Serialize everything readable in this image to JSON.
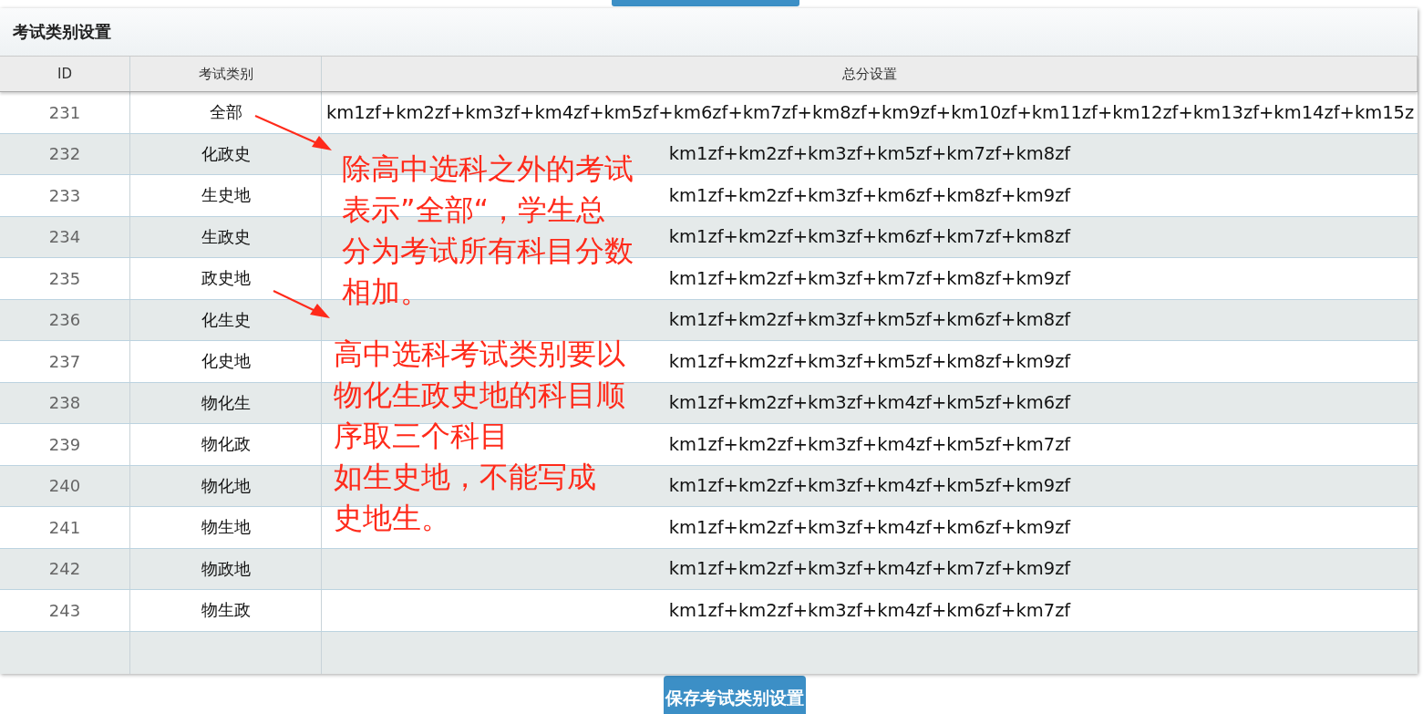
{
  "panel": {
    "title": "考试类别设置"
  },
  "table": {
    "columns": [
      "ID",
      "考试类别",
      "总分设置"
    ],
    "rows": [
      {
        "id": "231",
        "category": "全部",
        "total": "km1zf+km2zf+km3zf+km4zf+km5zf+km6zf+km7zf+km8zf+km9zf+km10zf+km11zf+km12zf+km13zf+km14zf+km15z"
      },
      {
        "id": "232",
        "category": "化政史",
        "total": "km1zf+km2zf+km3zf+km5zf+km7zf+km8zf"
      },
      {
        "id": "233",
        "category": "生史地",
        "total": "km1zf+km2zf+km3zf+km6zf+km8zf+km9zf"
      },
      {
        "id": "234",
        "category": "生政史",
        "total": "km1zf+km2zf+km3zf+km6zf+km7zf+km8zf"
      },
      {
        "id": "235",
        "category": "政史地",
        "total": "km1zf+km2zf+km3zf+km7zf+km8zf+km9zf"
      },
      {
        "id": "236",
        "category": "化生史",
        "total": "km1zf+km2zf+km3zf+km5zf+km6zf+km8zf"
      },
      {
        "id": "237",
        "category": "化史地",
        "total": "km1zf+km2zf+km3zf+km5zf+km8zf+km9zf"
      },
      {
        "id": "238",
        "category": "物化生",
        "total": "km1zf+km2zf+km3zf+km4zf+km5zf+km6zf"
      },
      {
        "id": "239",
        "category": "物化政",
        "total": "km1zf+km2zf+km3zf+km4zf+km5zf+km7zf"
      },
      {
        "id": "240",
        "category": "物化地",
        "total": "km1zf+km2zf+km3zf+km4zf+km5zf+km9zf"
      },
      {
        "id": "241",
        "category": "物生地",
        "total": "km1zf+km2zf+km3zf+km4zf+km6zf+km9zf"
      },
      {
        "id": "242",
        "category": "物政地",
        "total": "km1zf+km2zf+km3zf+km4zf+km7zf+km9zf"
      },
      {
        "id": "243",
        "category": "物生政",
        "total": "km1zf+km2zf+km3zf+km4zf+km6zf+km7zf"
      }
    ]
  },
  "annotations": [
    {
      "lines": [
        "除高中选科之外的考试",
        "表示”全部“，学生总",
        "分为考试所有科目分数",
        "相加。"
      ]
    },
    {
      "lines": [
        "高中选科考试类别要以",
        "物化生政史地的科目顺",
        "序取三个科目",
        "如生史地，不能写成",
        "史地生。"
      ]
    }
  ],
  "save_button": "保存考试类别设置"
}
